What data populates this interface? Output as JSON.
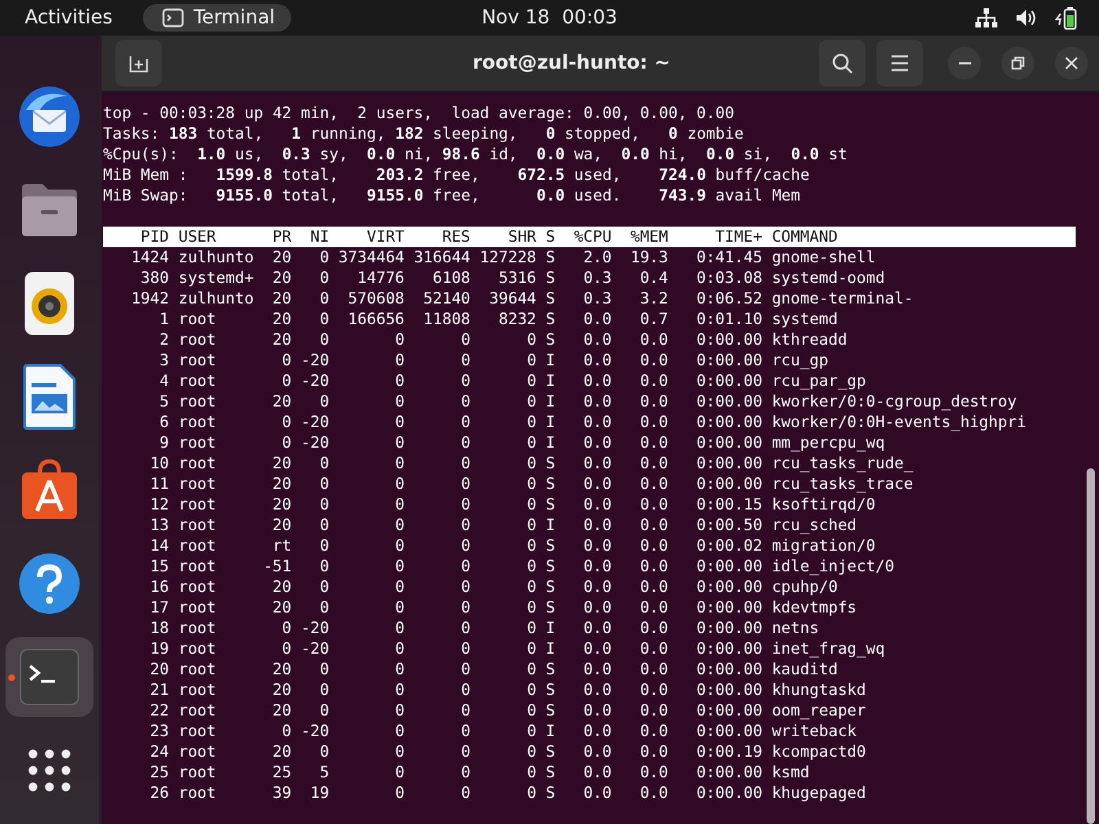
{
  "top_bar": {
    "activities": "Activities",
    "app_menu": "Terminal",
    "clock": "Nov 18  00:03"
  },
  "dock": {
    "items": [
      {
        "kind": "mail",
        "running": false
      },
      {
        "kind": "files",
        "running": false
      },
      {
        "kind": "music",
        "running": false
      },
      {
        "kind": "writer",
        "running": false
      },
      {
        "kind": "store",
        "running": false
      },
      {
        "kind": "help",
        "running": false
      },
      {
        "kind": "terminal",
        "running": true
      },
      {
        "kind": "grid",
        "running": false
      }
    ]
  },
  "window": {
    "title": "root@zul-hunto: ~"
  },
  "summary": [
    "top - 00:03:28 up 42 min,  2 users,  load average: 0.00, 0.00, 0.00",
    "Tasks: **183** total,   **1** running, **182** sleeping,   **0** stopped,   **0** zombie",
    "%Cpu(s):  **1.0** us,  **0.3** sy,  **0.0** ni, **98.6** id,  **0.0** wa,  **0.0** hi,  **0.0** si,  **0.0** st",
    "MiB Mem :   **1599.8** total,    **203.2** free,    **672.5** used,    **724.0** buff/cache",
    "MiB Swap:   **9155.0** total,   **9155.0** free,      **0.0** used.    **743.9** avail Mem"
  ],
  "table": {
    "columns": [
      "PID",
      "USER",
      "PR",
      "NI",
      "VIRT",
      "RES",
      "SHR",
      "S",
      "%CPU",
      "%MEM",
      "TIME+",
      "COMMAND"
    ],
    "rows": [
      [
        "1424",
        "zulhunto",
        "20",
        "0",
        "3734464",
        "316644",
        "127228",
        "S",
        "2.0",
        "19.3",
        "0:41.45",
        "gnome-shell"
      ],
      [
        "380",
        "systemd+",
        "20",
        "0",
        "14776",
        "6108",
        "5316",
        "S",
        "0.3",
        "0.4",
        "0:03.08",
        "systemd-oomd"
      ],
      [
        "1942",
        "zulhunto",
        "20",
        "0",
        "570608",
        "52140",
        "39644",
        "S",
        "0.3",
        "3.2",
        "0:06.52",
        "gnome-terminal-"
      ],
      [
        "1",
        "root",
        "20",
        "0",
        "166656",
        "11808",
        "8232",
        "S",
        "0.0",
        "0.7",
        "0:01.10",
        "systemd"
      ],
      [
        "2",
        "root",
        "20",
        "0",
        "0",
        "0",
        "0",
        "S",
        "0.0",
        "0.0",
        "0:00.00",
        "kthreadd"
      ],
      [
        "3",
        "root",
        "0",
        "-20",
        "0",
        "0",
        "0",
        "I",
        "0.0",
        "0.0",
        "0:00.00",
        "rcu_gp"
      ],
      [
        "4",
        "root",
        "0",
        "-20",
        "0",
        "0",
        "0",
        "I",
        "0.0",
        "0.0",
        "0:00.00",
        "rcu_par_gp"
      ],
      [
        "5",
        "root",
        "20",
        "0",
        "0",
        "0",
        "0",
        "I",
        "0.0",
        "0.0",
        "0:00.00",
        "kworker/0:0-cgroup_destroy"
      ],
      [
        "6",
        "root",
        "0",
        "-20",
        "0",
        "0",
        "0",
        "I",
        "0.0",
        "0.0",
        "0:00.00",
        "kworker/0:0H-events_highpri"
      ],
      [
        "9",
        "root",
        "0",
        "-20",
        "0",
        "0",
        "0",
        "I",
        "0.0",
        "0.0",
        "0:00.00",
        "mm_percpu_wq"
      ],
      [
        "10",
        "root",
        "20",
        "0",
        "0",
        "0",
        "0",
        "S",
        "0.0",
        "0.0",
        "0:00.00",
        "rcu_tasks_rude_"
      ],
      [
        "11",
        "root",
        "20",
        "0",
        "0",
        "0",
        "0",
        "S",
        "0.0",
        "0.0",
        "0:00.00",
        "rcu_tasks_trace"
      ],
      [
        "12",
        "root",
        "20",
        "0",
        "0",
        "0",
        "0",
        "S",
        "0.0",
        "0.0",
        "0:00.15",
        "ksoftirqd/0"
      ],
      [
        "13",
        "root",
        "20",
        "0",
        "0",
        "0",
        "0",
        "I",
        "0.0",
        "0.0",
        "0:00.50",
        "rcu_sched"
      ],
      [
        "14",
        "root",
        "rt",
        "0",
        "0",
        "0",
        "0",
        "S",
        "0.0",
        "0.0",
        "0:00.02",
        "migration/0"
      ],
      [
        "15",
        "root",
        "-51",
        "0",
        "0",
        "0",
        "0",
        "S",
        "0.0",
        "0.0",
        "0:00.00",
        "idle_inject/0"
      ],
      [
        "16",
        "root",
        "20",
        "0",
        "0",
        "0",
        "0",
        "S",
        "0.0",
        "0.0",
        "0:00.00",
        "cpuhp/0"
      ],
      [
        "17",
        "root",
        "20",
        "0",
        "0",
        "0",
        "0",
        "S",
        "0.0",
        "0.0",
        "0:00.00",
        "kdevtmpfs"
      ],
      [
        "18",
        "root",
        "0",
        "-20",
        "0",
        "0",
        "0",
        "I",
        "0.0",
        "0.0",
        "0:00.00",
        "netns"
      ],
      [
        "19",
        "root",
        "0",
        "-20",
        "0",
        "0",
        "0",
        "I",
        "0.0",
        "0.0",
        "0:00.00",
        "inet_frag_wq"
      ],
      [
        "20",
        "root",
        "20",
        "0",
        "0",
        "0",
        "0",
        "S",
        "0.0",
        "0.0",
        "0:00.00",
        "kauditd"
      ],
      [
        "21",
        "root",
        "20",
        "0",
        "0",
        "0",
        "0",
        "S",
        "0.0",
        "0.0",
        "0:00.00",
        "khungtaskd"
      ],
      [
        "22",
        "root",
        "20",
        "0",
        "0",
        "0",
        "0",
        "S",
        "0.0",
        "0.0",
        "0:00.00",
        "oom_reaper"
      ],
      [
        "23",
        "root",
        "0",
        "-20",
        "0",
        "0",
        "0",
        "I",
        "0.0",
        "0.0",
        "0:00.00",
        "writeback"
      ],
      [
        "24",
        "root",
        "20",
        "0",
        "0",
        "0",
        "0",
        "S",
        "0.0",
        "0.0",
        "0:00.19",
        "kcompactd0"
      ],
      [
        "25",
        "root",
        "25",
        "5",
        "0",
        "0",
        "0",
        "S",
        "0.0",
        "0.0",
        "0:00.00",
        "ksmd"
      ],
      [
        "26",
        "root",
        "39",
        "19",
        "0",
        "0",
        "0",
        "S",
        "0.0",
        "0.0",
        "0:00.00",
        "khugepaged"
      ]
    ]
  }
}
